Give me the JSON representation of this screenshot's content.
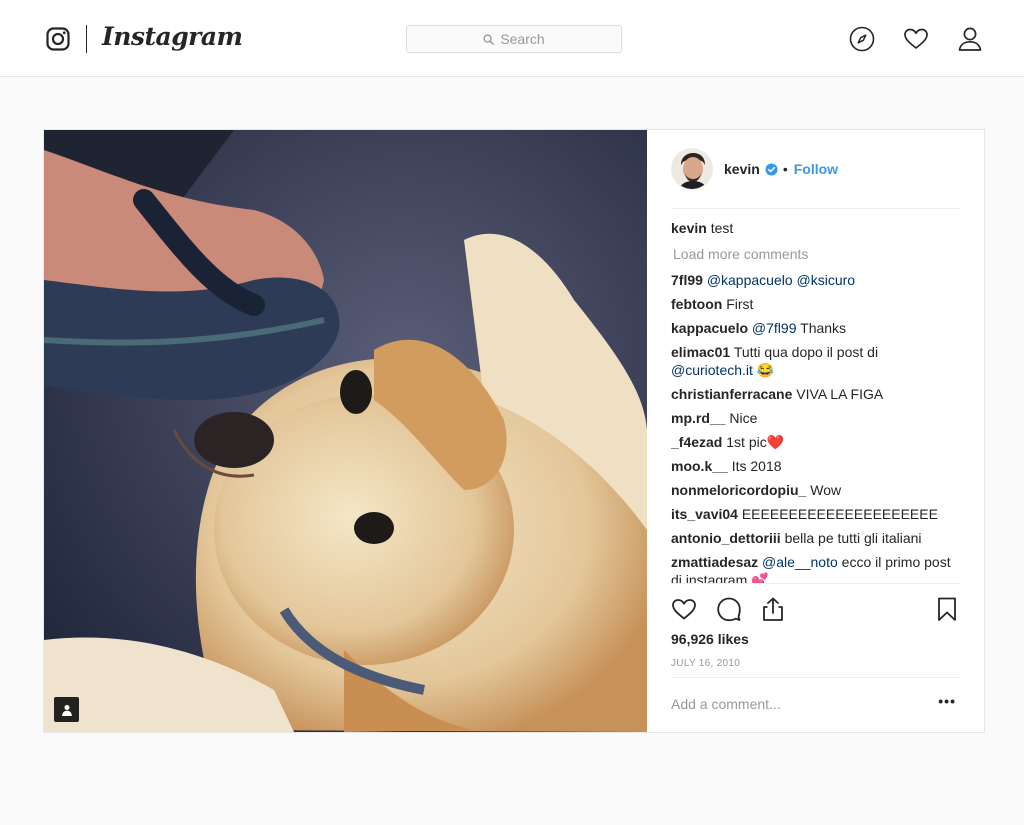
{
  "header": {
    "wordmark": "Instagram",
    "search_placeholder": "Search",
    "icons": [
      "instagram-logo-icon",
      "search-icon",
      "explore-compass-icon",
      "activity-heart-icon",
      "profile-person-icon"
    ]
  },
  "post": {
    "username": "kevin",
    "follow_label": "Follow",
    "dot": "•",
    "caption": {
      "user": "kevin",
      "text": "test"
    },
    "load_more": "Load more comments",
    "comments": [
      {
        "user": "7fl99",
        "parts": [
          {
            "t": "@kappacuelo",
            "m": true
          },
          {
            "t": " "
          },
          {
            "t": "@ksicuro",
            "m": true
          }
        ]
      },
      {
        "user": "febtoon",
        "parts": [
          {
            "t": "First"
          }
        ]
      },
      {
        "user": "kappacuelo",
        "parts": [
          {
            "t": "@7fl99",
            "m": true
          },
          {
            "t": " Thanks"
          }
        ]
      },
      {
        "user": "elimac01",
        "parts": [
          {
            "t": "Tutti qua dopo il post di "
          },
          {
            "t": "@curiotech.it",
            "m": true
          },
          {
            "t": " 😂"
          }
        ]
      },
      {
        "user": "christianferracane",
        "parts": [
          {
            "t": "VIVA LA FIGA"
          }
        ]
      },
      {
        "user": "mp.rd__",
        "parts": [
          {
            "t": "Nice"
          }
        ]
      },
      {
        "user": "_f4ezad",
        "parts": [
          {
            "t": "1st pic❤️"
          }
        ]
      },
      {
        "user": "moo.k__",
        "parts": [
          {
            "t": "Its 2018"
          }
        ]
      },
      {
        "user": "nonmeloricordopiu_",
        "parts": [
          {
            "t": "Wow"
          }
        ]
      },
      {
        "user": "its_vavi04",
        "parts": [
          {
            "t": "EEEEEEEEEEEEEEEEEEEEE"
          }
        ]
      },
      {
        "user": "antonio_dettoriii",
        "parts": [
          {
            "t": "bella pe tutti gli italiani"
          }
        ]
      },
      {
        "user": "zmattiadesaz",
        "parts": [
          {
            "t": "@ale__noto",
            "m": true
          },
          {
            "t": " ecco il primo post di instagram 💕"
          }
        ]
      }
    ],
    "likes": "96,926 likes",
    "date": "JULY 16, 2010",
    "add_comment_placeholder": "Add a comment...",
    "more_label": "•••",
    "action_icons": [
      "like-heart-icon",
      "comment-bubble-icon",
      "share-icon",
      "save-bookmark-icon"
    ]
  },
  "colors": {
    "accent": "#3897f0",
    "mention": "#003569",
    "muted": "#999999",
    "border": "#efefef"
  }
}
